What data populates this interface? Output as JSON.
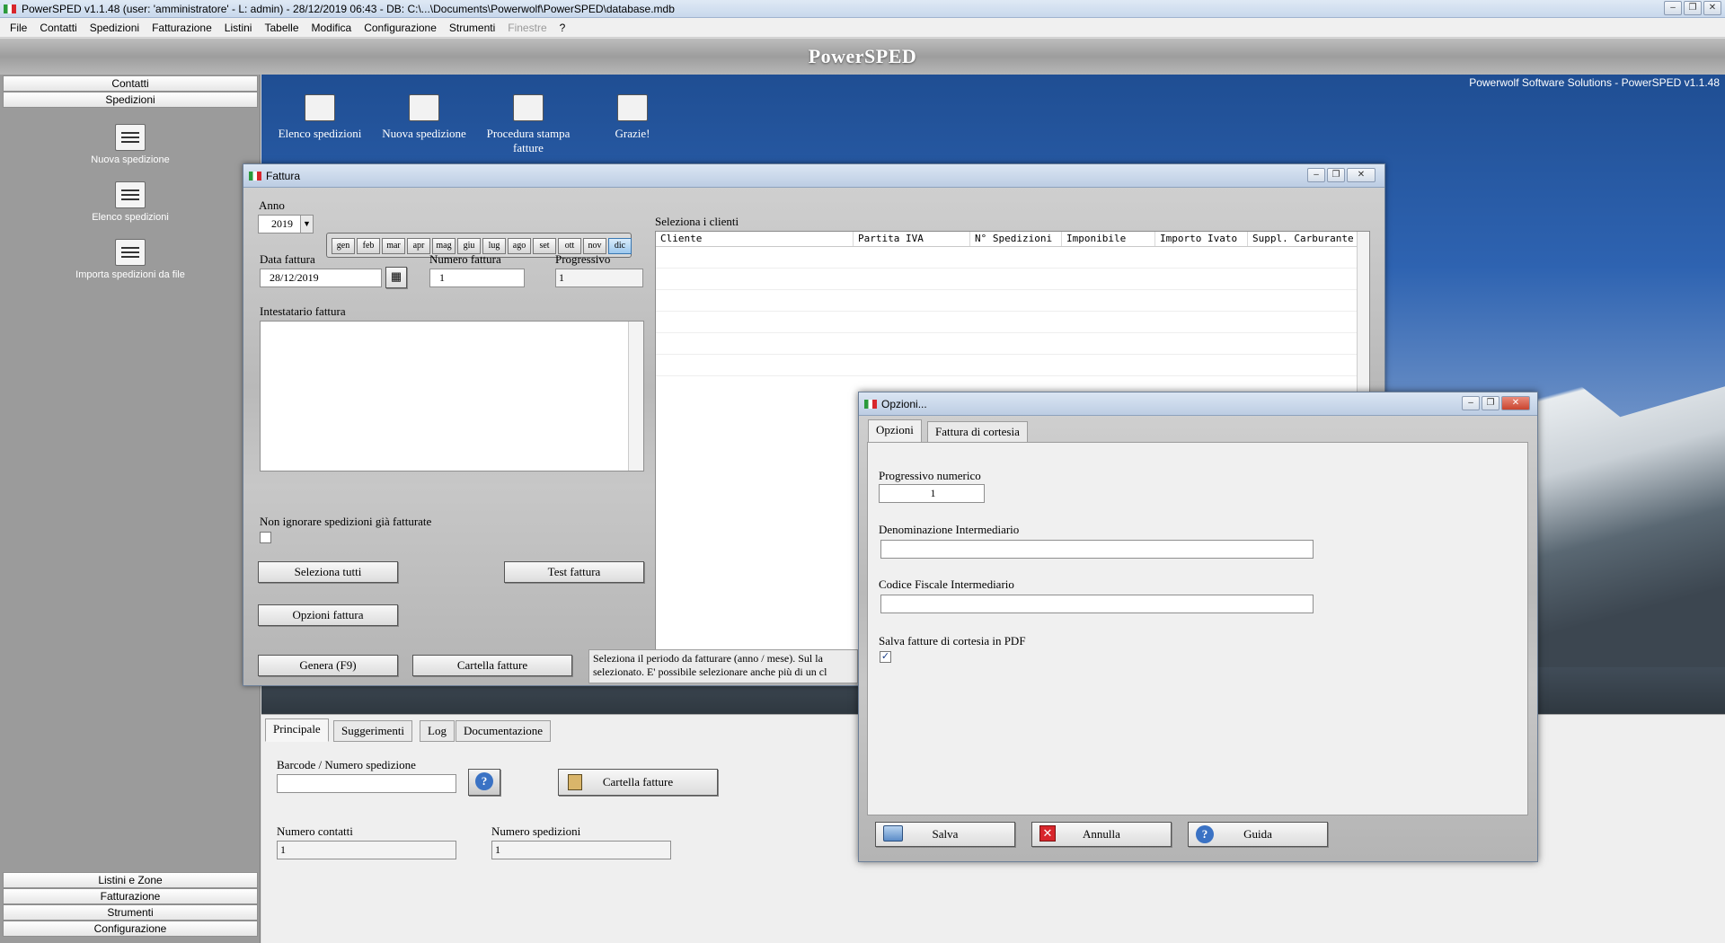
{
  "app": {
    "title": "PowerSPED v1.1.48  (user: 'amministratore'  - L: admin) - 28/12/2019 06:43 - DB: C:\\...\\Documents\\Powerwolf\\PowerSPED\\database.mdb",
    "brand": "PowerSPED",
    "credit": "Powerwolf Software Solutions - PowerSPED v1.1.48"
  },
  "menu": [
    "File",
    "Contatti",
    "Spedizioni",
    "Fatturazione",
    "Listini",
    "Tabelle",
    "Modifica",
    "Configurazione",
    "Strumenti",
    "Finestre",
    "?"
  ],
  "sidebar": {
    "top": [
      "Contatti",
      "Spedizioni"
    ],
    "items": [
      "Nuova spedizione",
      "Elenco spedizioni",
      "Importa spedizioni da file"
    ],
    "bottom": [
      "Listini e Zone",
      "Fatturazione",
      "Strumenti",
      "Configurazione"
    ]
  },
  "desktop": {
    "icons": [
      "Elenco spedizioni",
      "Nuova spedizione",
      "Procedura stampa fatture",
      "Grazie!"
    ]
  },
  "bottom": {
    "tabs": [
      "Principale",
      "Suggerimenti",
      "Log",
      "Documentazione"
    ],
    "barcode_label": "Barcode / Numero spedizione",
    "barcode_value": "",
    "cartella_button": "Cartella fatture",
    "num_contatti_label": "Numero contatti",
    "num_contatti_value": "1",
    "num_spedizioni_label": "Numero spedizioni",
    "num_spedizioni_value": "1"
  },
  "fattura": {
    "title": "Fattura",
    "anno_label": "Anno",
    "anno_value": "2019",
    "months": [
      "gen",
      "feb",
      "mar",
      "apr",
      "mag",
      "giu",
      "lug",
      "ago",
      "set",
      "ott",
      "nov",
      "dic"
    ],
    "selected_month": "dic",
    "data_label": "Data fattura",
    "data_value": "28/12/2019",
    "numero_label": "Numero fattura",
    "numero_value": "1",
    "progressivo_label": "Progressivo",
    "progressivo_value": "1",
    "intestatario_label": "Intestatario fattura",
    "intestatario_value": "",
    "non_ignorare_label": "Non ignorare spedizioni già fatturate",
    "non_ignorare_checked": false,
    "seleziona_tutti": "Seleziona tutti",
    "test_fattura": "Test fattura",
    "opzioni_fattura": "Opzioni fattura",
    "genera": "Genera (F9)",
    "cartella": "Cartella fatture",
    "clienti_label": "Seleziona i clienti",
    "columns": [
      "Cliente",
      "Partita IVA",
      "N° Spedizioni",
      "Imponibile",
      "Importo Ivato",
      "Suppl. Carburante"
    ],
    "hint_line1": "Seleziona il periodo da fatturare (anno  / mese). Sul la",
    "hint_line2": "selezionato. E' possibile selezionare anche più di un cl"
  },
  "opzioni": {
    "title": "Opzioni...",
    "tabs": [
      "Opzioni",
      "Fattura di cortesia"
    ],
    "progressivo_label": "Progressivo numerico",
    "progressivo_value": "1",
    "denominazione_label": "Denominazione Intermediario",
    "denominazione_value": "",
    "codice_label": "Codice Fiscale Intermediario",
    "codice_value": "",
    "salva_pdf_label": "Salva fatture di cortesia in PDF",
    "salva_pdf_checked": true,
    "salva": "Salva",
    "annulla": "Annulla",
    "guida": "Guida"
  }
}
